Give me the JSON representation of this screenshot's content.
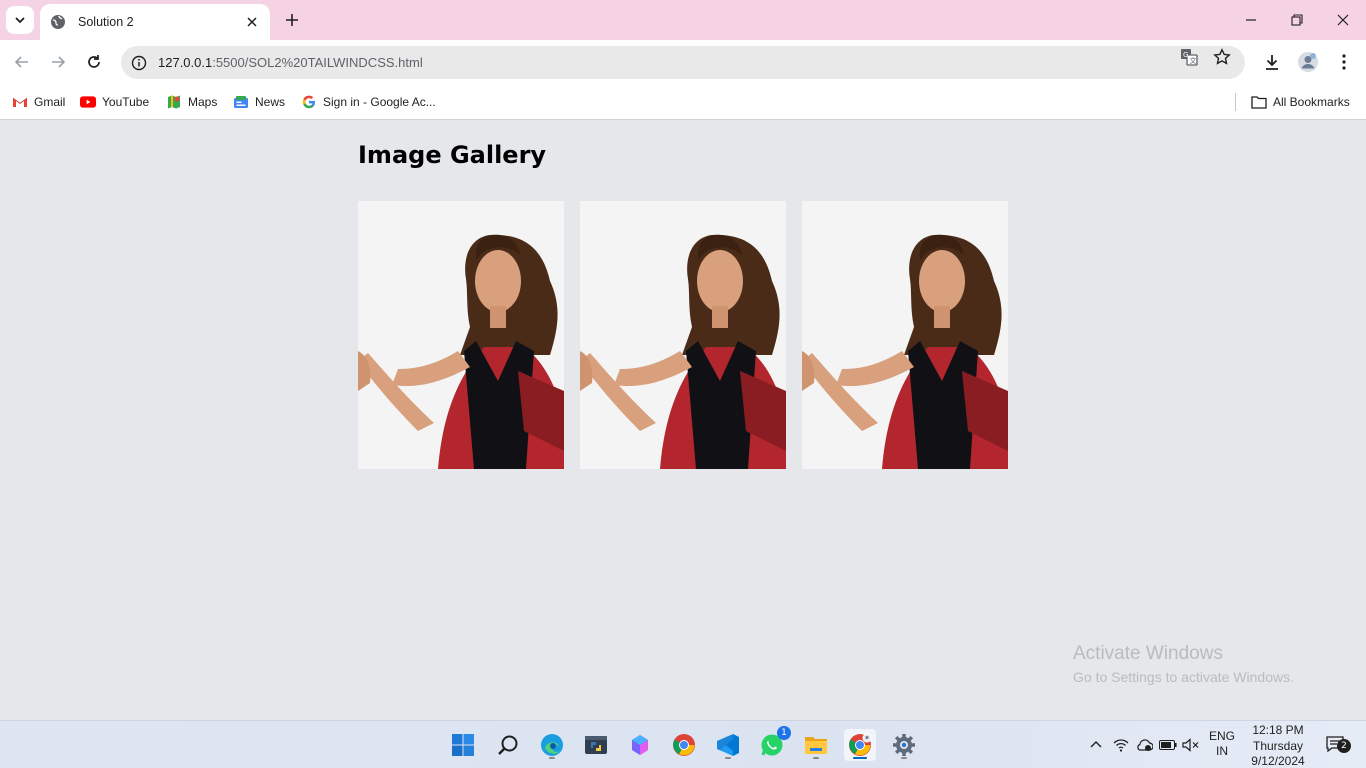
{
  "browser": {
    "tab_title": "Solution 2",
    "url_host": "127.0.0.1",
    "url_path": ":5500/SOL2%20TAILWINDCSS.html",
    "bookmarks": [
      {
        "label": "Gmail",
        "icon": "gmail-icon"
      },
      {
        "label": "YouTube",
        "icon": "youtube-icon"
      },
      {
        "label": "Maps",
        "icon": "maps-icon"
      },
      {
        "label": "News",
        "icon": "news-icon"
      },
      {
        "label": "Sign in - Google Ac...",
        "icon": "google-icon"
      }
    ],
    "all_bookmarks": "All Bookmarks"
  },
  "page": {
    "title": "Image Gallery",
    "images": [
      {
        "alt": "woman-pointing-photo"
      },
      {
        "alt": "woman-pointing-photo"
      },
      {
        "alt": "woman-pointing-photo"
      }
    ]
  },
  "watermark": {
    "heading": "Activate Windows",
    "sub": "Go to Settings to activate Windows."
  },
  "taskbar": {
    "whatsapp_badge": "1",
    "notification_badge": "2",
    "lang_line1": "ENG",
    "lang_line2": "IN",
    "time": "12:18 PM",
    "day": "Thursday",
    "date": "9/12/2024"
  },
  "colors": {
    "tabstrip": "#f5d3e4",
    "page_bg": "#e5e7eb",
    "accent": "#0067c0"
  }
}
